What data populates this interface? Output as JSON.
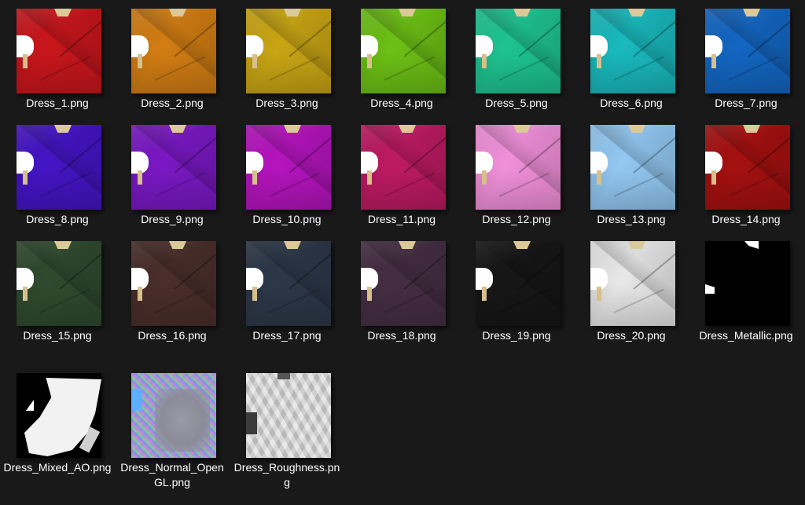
{
  "files": [
    {
      "name": "Dress_1.png",
      "color": "#c8161c"
    },
    {
      "name": "Dress_2.png",
      "color": "#d27d13"
    },
    {
      "name": "Dress_3.png",
      "color": "#c9a514"
    },
    {
      "name": "Dress_4.png",
      "color": "#6cc015"
    },
    {
      "name": "Dress_5.png",
      "color": "#1ec391"
    },
    {
      "name": "Dress_6.png",
      "color": "#19b9bd"
    },
    {
      "name": "Dress_7.png",
      "color": "#1366c2"
    },
    {
      "name": "Dress_8.png",
      "color": "#4414c4"
    },
    {
      "name": "Dress_9.png",
      "color": "#7a18c4"
    },
    {
      "name": "Dress_10.png",
      "color": "#b414bd"
    },
    {
      "name": "Dress_11.png",
      "color": "#bd1a62"
    },
    {
      "name": "Dress_12.png",
      "color": "#f190da"
    },
    {
      "name": "Dress_13.png",
      "color": "#93c8f2"
    },
    {
      "name": "Dress_14.png",
      "color": "#a51010"
    },
    {
      "name": "Dress_15.png",
      "color": "#2f4a2e"
    },
    {
      "name": "Dress_16.png",
      "color": "#4a2e2a"
    },
    {
      "name": "Dress_17.png",
      "color": "#2c3748"
    },
    {
      "name": "Dress_18.png",
      "color": "#452e43"
    },
    {
      "name": "Dress_19.png",
      "color": "#161616"
    },
    {
      "name": "Dress_20.png",
      "color": "#e8e8e8"
    },
    {
      "name": "Dress_Metallic.png",
      "kind": "metallic"
    },
    {
      "name": "Dress_Mixed_AO.png",
      "kind": "ao"
    },
    {
      "name": "Dress_Normal_OpenGL.png",
      "kind": "normal"
    },
    {
      "name": "Dress_Roughness.png",
      "kind": "roughness"
    }
  ]
}
